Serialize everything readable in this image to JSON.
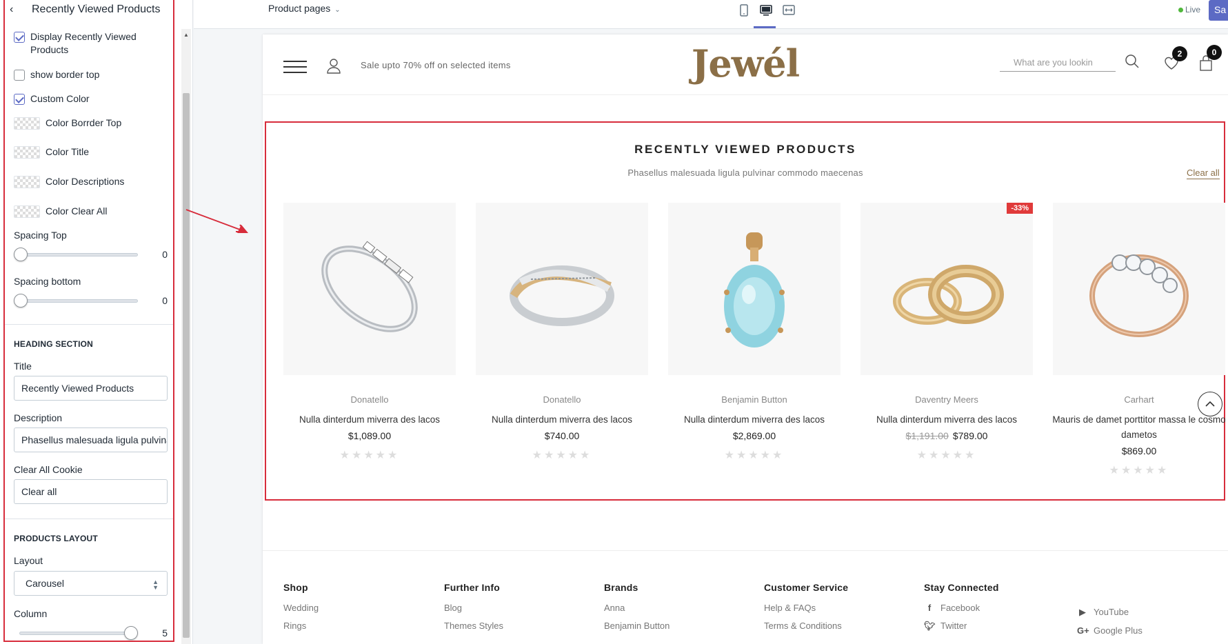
{
  "sidebar": {
    "title": "Recently Viewed Products",
    "checkboxes": [
      {
        "label": "Display Recently Viewed Products",
        "checked": true
      },
      {
        "label": "show border top",
        "checked": false
      },
      {
        "label": "Custom Color",
        "checked": true
      }
    ],
    "colors": [
      {
        "label": "Color Borrder Top"
      },
      {
        "label": "Color Title"
      },
      {
        "label": "Color Descriptions"
      },
      {
        "label": "Color Clear All"
      }
    ],
    "spacing_top": {
      "label": "Spacing Top",
      "value": "0"
    },
    "spacing_bottom": {
      "label": "Spacing bottom",
      "value": "0"
    },
    "heading_section": {
      "heading": "HEADING SECTION",
      "title_label": "Title",
      "title_value": "Recently Viewed Products",
      "description_label": "Description",
      "description_value": "Phasellus malesuada ligula pulvinar commodo maecenas",
      "clear_label": "Clear All Cookie",
      "clear_value": "Clear all"
    },
    "products_layout": {
      "heading": "PRODUCTS LAYOUT",
      "layout_label": "Layout",
      "layout_value": "Carousel",
      "column_label": "Column",
      "column_value": "5",
      "column_fraction": 1.0
    }
  },
  "topbar": {
    "page_selector": "Product pages",
    "live_label": "Live",
    "save_label": "Sa",
    "devices": [
      "mobile-icon",
      "desktop-icon",
      "fullwidth-icon"
    ],
    "active_device": "desktop-icon"
  },
  "store": {
    "promo": "Sale upto 70% off on selected items",
    "logo": "Jewél",
    "search_placeholder": "What are you lookin",
    "wishlist_count": "2",
    "cart_count": "0",
    "accent_color": "#8b6f47"
  },
  "recently_viewed": {
    "title": "RECENTLY VIEWED PRODUCTS",
    "description": "Phasellus malesuada ligula pulvinar commodo maecenas",
    "clear_all": "Clear all",
    "products": [
      {
        "vendor": "Donatello",
        "name": "Nulla dinterdum miverra des lacos",
        "price": "$1,089.00",
        "old_price": "",
        "badge": "",
        "image": "silver-baguette-ring"
      },
      {
        "vendor": "Donatello",
        "name": "Nulla dinterdum miverra des lacos",
        "price": "$740.00",
        "old_price": "",
        "badge": "",
        "image": "crossover-ring"
      },
      {
        "vendor": "Benjamin Button",
        "name": "Nulla dinterdum miverra des lacos",
        "price": "$2,869.00",
        "old_price": "",
        "badge": "",
        "image": "aquamarine-pendant"
      },
      {
        "vendor": "Daventry Meers",
        "name": "Nulla dinterdum miverra des lacos",
        "price": "$789.00",
        "old_price": "$1,191.00",
        "badge": "-33%",
        "image": "gold-band-pair"
      },
      {
        "vendor": "Carhart",
        "name": "Mauris de damet porttitor massa le cosmo dametos",
        "price": "$869.00",
        "old_price": "",
        "badge": "",
        "image": "diamond-rose-ring"
      }
    ]
  },
  "footer": {
    "columns": [
      {
        "heading": "Shop",
        "links": [
          "Wedding",
          "Rings"
        ]
      },
      {
        "heading": "Further Info",
        "links": [
          "Blog",
          "Themes Styles"
        ]
      },
      {
        "heading": "Brands",
        "links": [
          "Anna",
          "Benjamin Button"
        ]
      },
      {
        "heading": "Customer Service",
        "links": [
          "Help & FAQs",
          "Terms & Conditions"
        ]
      },
      {
        "heading": "Stay Connected",
        "links": [
          "Facebook",
          "Twitter"
        ],
        "icons": [
          "facebook-icon",
          "twitter-icon"
        ]
      },
      {
        "heading": "",
        "links": [
          "YouTube",
          "Google Plus"
        ],
        "icons": [
          "youtube-icon",
          "google-plus-icon"
        ]
      }
    ]
  }
}
